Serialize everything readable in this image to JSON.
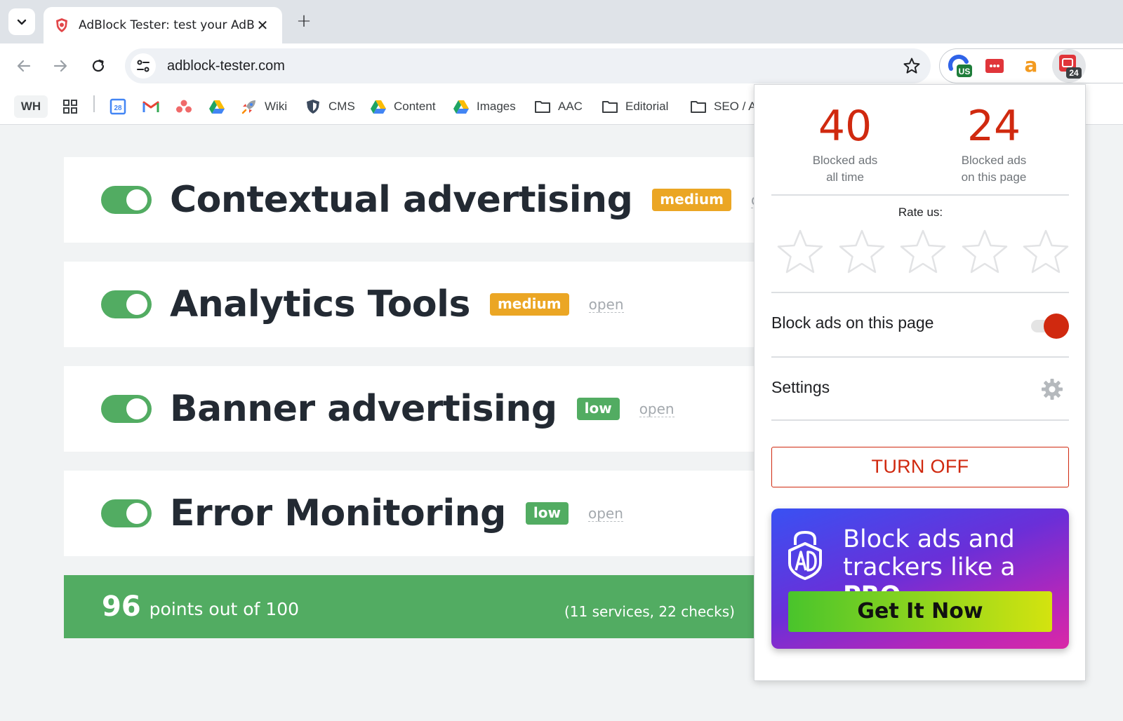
{
  "browser": {
    "tab": {
      "title": "AdBlock Tester: test your AdBlocker"
    },
    "url": "adblock-tester.com",
    "extensions": [
      {
        "name": "vpn-extension",
        "badge": "US"
      },
      {
        "name": "dots-extension"
      },
      {
        "name": "amazon-extension",
        "glyph": "a"
      },
      {
        "name": "adblock-extension",
        "badge": "24"
      }
    ],
    "bookmarks": [
      {
        "label": "WH"
      },
      {
        "label": ""
      },
      {
        "label": "",
        "icon": "calendar-icon",
        "icon_text": "28"
      },
      {
        "label": "",
        "icon": "gmail-icon"
      },
      {
        "label": "",
        "icon": "asana-icon"
      },
      {
        "label": "",
        "icon": "drive-icon"
      },
      {
        "label": "Wiki",
        "icon": "rocket-icon"
      },
      {
        "label": "CMS",
        "icon": "shield-icon"
      },
      {
        "label": "Content",
        "icon": "drive-icon"
      },
      {
        "label": "Images",
        "icon": "drive-icon"
      },
      {
        "label": "AAC",
        "icon": "folder-icon"
      },
      {
        "label": "Editorial",
        "icon": "folder-icon"
      },
      {
        "label": "SEO / A",
        "icon": "folder-icon"
      }
    ]
  },
  "page": {
    "services": [
      {
        "title": "Contextual advertising",
        "level": "medium",
        "link": "open"
      },
      {
        "title": "Analytics Tools",
        "level": "medium",
        "link": "open"
      },
      {
        "title": "Banner advertising",
        "level": "low",
        "link": "open"
      },
      {
        "title": "Error Monitoring",
        "level": "low",
        "link": "open"
      }
    ],
    "score": {
      "points": "96",
      "text": "points out of 100",
      "detail": "(11 services, 22 checks)"
    }
  },
  "popup": {
    "stats": [
      {
        "value": "40",
        "label_line1": "Blocked ads",
        "label_line2": "all time"
      },
      {
        "value": "24",
        "label_line1": "Blocked ads",
        "label_line2": "on this page"
      }
    ],
    "rate_label": "Rate us:",
    "rating": 0,
    "block_label": "Block ads on this page",
    "block_enabled": true,
    "settings_label": "Settings",
    "turn_off_label": "TURN OFF",
    "promo": {
      "line1": "Block ads and",
      "line2": "trackers like a",
      "line2_bold": "PRO",
      "button": "Get It Now"
    }
  },
  "colors": {
    "accent_red": "#d0290f",
    "green": "#52ac62",
    "medium_badge": "#eba624"
  }
}
